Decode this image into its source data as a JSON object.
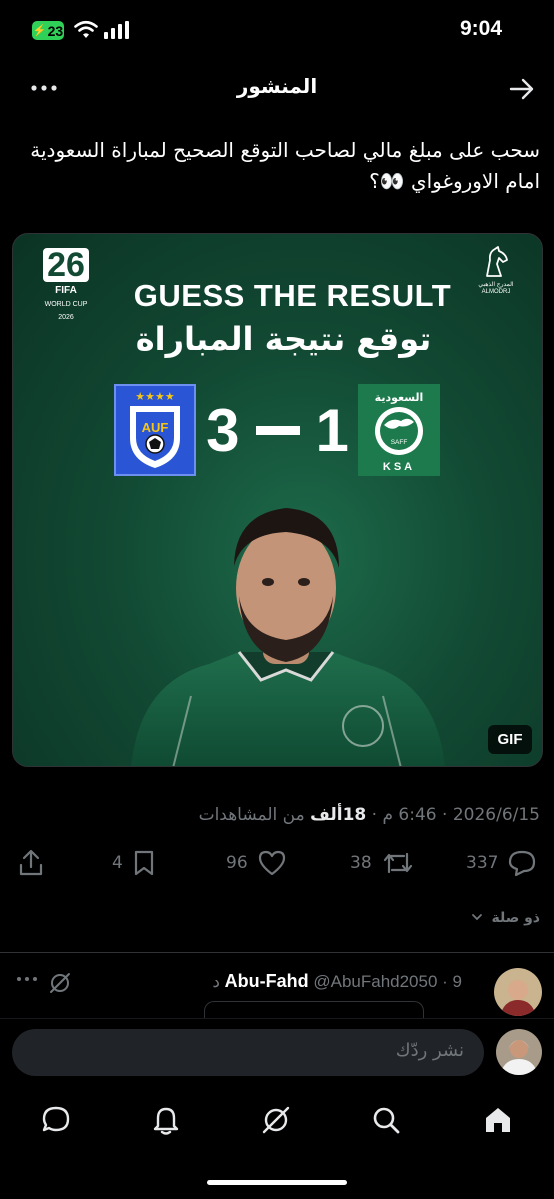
{
  "status_bar": {
    "battery": "23",
    "time": "9:04"
  },
  "header": {
    "title": "المنشور"
  },
  "post": {
    "text": "سحب على مبلغ مالي لصاحب التوقع الصحيح لمباراة السعودية امام الاوروغواي 👀؟",
    "media": {
      "logo_26": "26",
      "fifa": "FIFA",
      "world_cup": "WORLD CUP",
      "year": "2026",
      "brand_ar": "المدرج الذهبي",
      "brand_en": "ALMODRJ",
      "headline_en": "GUESS THE RESULT",
      "headline_ar": "توقع نتيجة المباراة",
      "score_left": "3",
      "score_right": "1",
      "ksa_ar": "السعودية",
      "ksa_saff": "SAFF",
      "ksa_en": "KSA",
      "uru_letters": "AUF",
      "gif_label": "GIF",
      "colors": {
        "bg": "#124a34",
        "uruguay_blue": "#2a56d6",
        "ksa_green": "#1c7a4c"
      }
    },
    "meta": {
      "date": "2026/6/15",
      "time": "6:46 م",
      "views_count": "18ألف",
      "views_label": "من المشاهدات",
      "separator": " · "
    },
    "actions": {
      "replies": "337",
      "reposts": "38",
      "likes": "96",
      "bookmarks": "4"
    },
    "related_label": "ذو صلة"
  },
  "reply_preview": {
    "name": "Abu-Fahd",
    "handle": "@AbuFahd2050",
    "time": "9 د"
  },
  "compose": {
    "placeholder": "نشر ردّك"
  },
  "tabbar": [
    "home-icon",
    "search-icon",
    "grok-icon",
    "notifications-icon",
    "messages-icon"
  ]
}
